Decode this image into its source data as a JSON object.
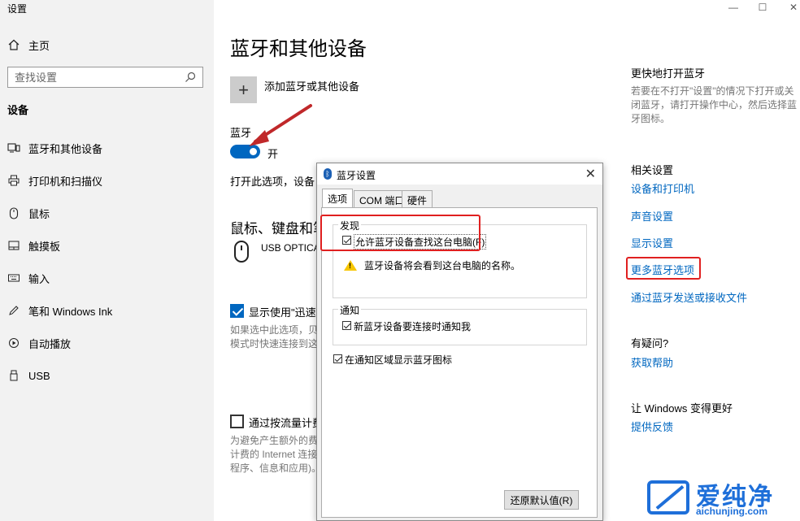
{
  "window": {
    "title": "设置",
    "minimize": "—",
    "maximize": "☐",
    "close": "✕"
  },
  "sidebar": {
    "home": "主页",
    "search_placeholder": "查找设置",
    "section": "设备",
    "items": [
      {
        "label": "蓝牙和其他设备",
        "icon": "bluetooth-devices-icon"
      },
      {
        "label": "打印机和扫描仪",
        "icon": "printer-icon"
      },
      {
        "label": "鼠标",
        "icon": "mouse-icon"
      },
      {
        "label": "触摸板",
        "icon": "touchpad-icon"
      },
      {
        "label": "输入",
        "icon": "keyboard-icon"
      },
      {
        "label": "笔和 Windows Ink",
        "icon": "pen-icon"
      },
      {
        "label": "自动播放",
        "icon": "autoplay-icon"
      },
      {
        "label": "USB",
        "icon": "usb-icon"
      }
    ]
  },
  "main": {
    "title": "蓝牙和其他设备",
    "add_device": "添加蓝牙或其他设备",
    "bluetooth_label": "蓝牙",
    "bluetooth_state": "开",
    "bluetooth_desc": "打开此选项，设备 I",
    "section_heading": "鼠标、键盘和笔",
    "device_name": "USB OPTICA",
    "show_notify_label": "显示使用\"迅速配",
    "show_notify_desc1": "如果选中此选项，贝",
    "show_notify_desc2": "模式时快速连接到这",
    "metered_label": "通过按流量计费",
    "metered_desc1": "为避免产生额外的费",
    "metered_desc2": "计费的 Internet 连接",
    "metered_desc3": "程序、信息和应用)。"
  },
  "right": {
    "quick_open_heading": "更快地打开蓝牙",
    "quick_open_desc": "若要在不打开\"设置\"的情况下打开或关闭蓝牙，请打开操作中心，然后选择蓝牙图标。",
    "related_heading": "相关设置",
    "links": [
      "设备和打印机",
      "声音设置",
      "显示设置",
      "更多蓝牙选项",
      "通过蓝牙发送或接收文件"
    ],
    "help_heading": "有疑问?",
    "help_link": "获取帮助",
    "improve_heading": "让 Windows 变得更好",
    "feedback_link": "提供反馈"
  },
  "dialog": {
    "title": "蓝牙设置",
    "tabs": [
      "选项",
      "COM 端口",
      "硬件"
    ],
    "discovery_group": "发现",
    "allow_discover": "允许蓝牙设备查找这台电脑(F)",
    "warning": "蓝牙设备将会看到这台电脑的名称。",
    "notify_group": "通知",
    "notify_new": "新蓝牙设备要连接时通知我",
    "show_tray_icon": "在通知区域显示蓝牙图标",
    "restore_button": "还原默认值(R)"
  },
  "watermark": {
    "brand": "爱纯净",
    "url": "aichunjing.com"
  },
  "colors": {
    "accent": "#0067c0",
    "highlight": "#e02020",
    "sidebar_bg": "#f2f2f2"
  }
}
